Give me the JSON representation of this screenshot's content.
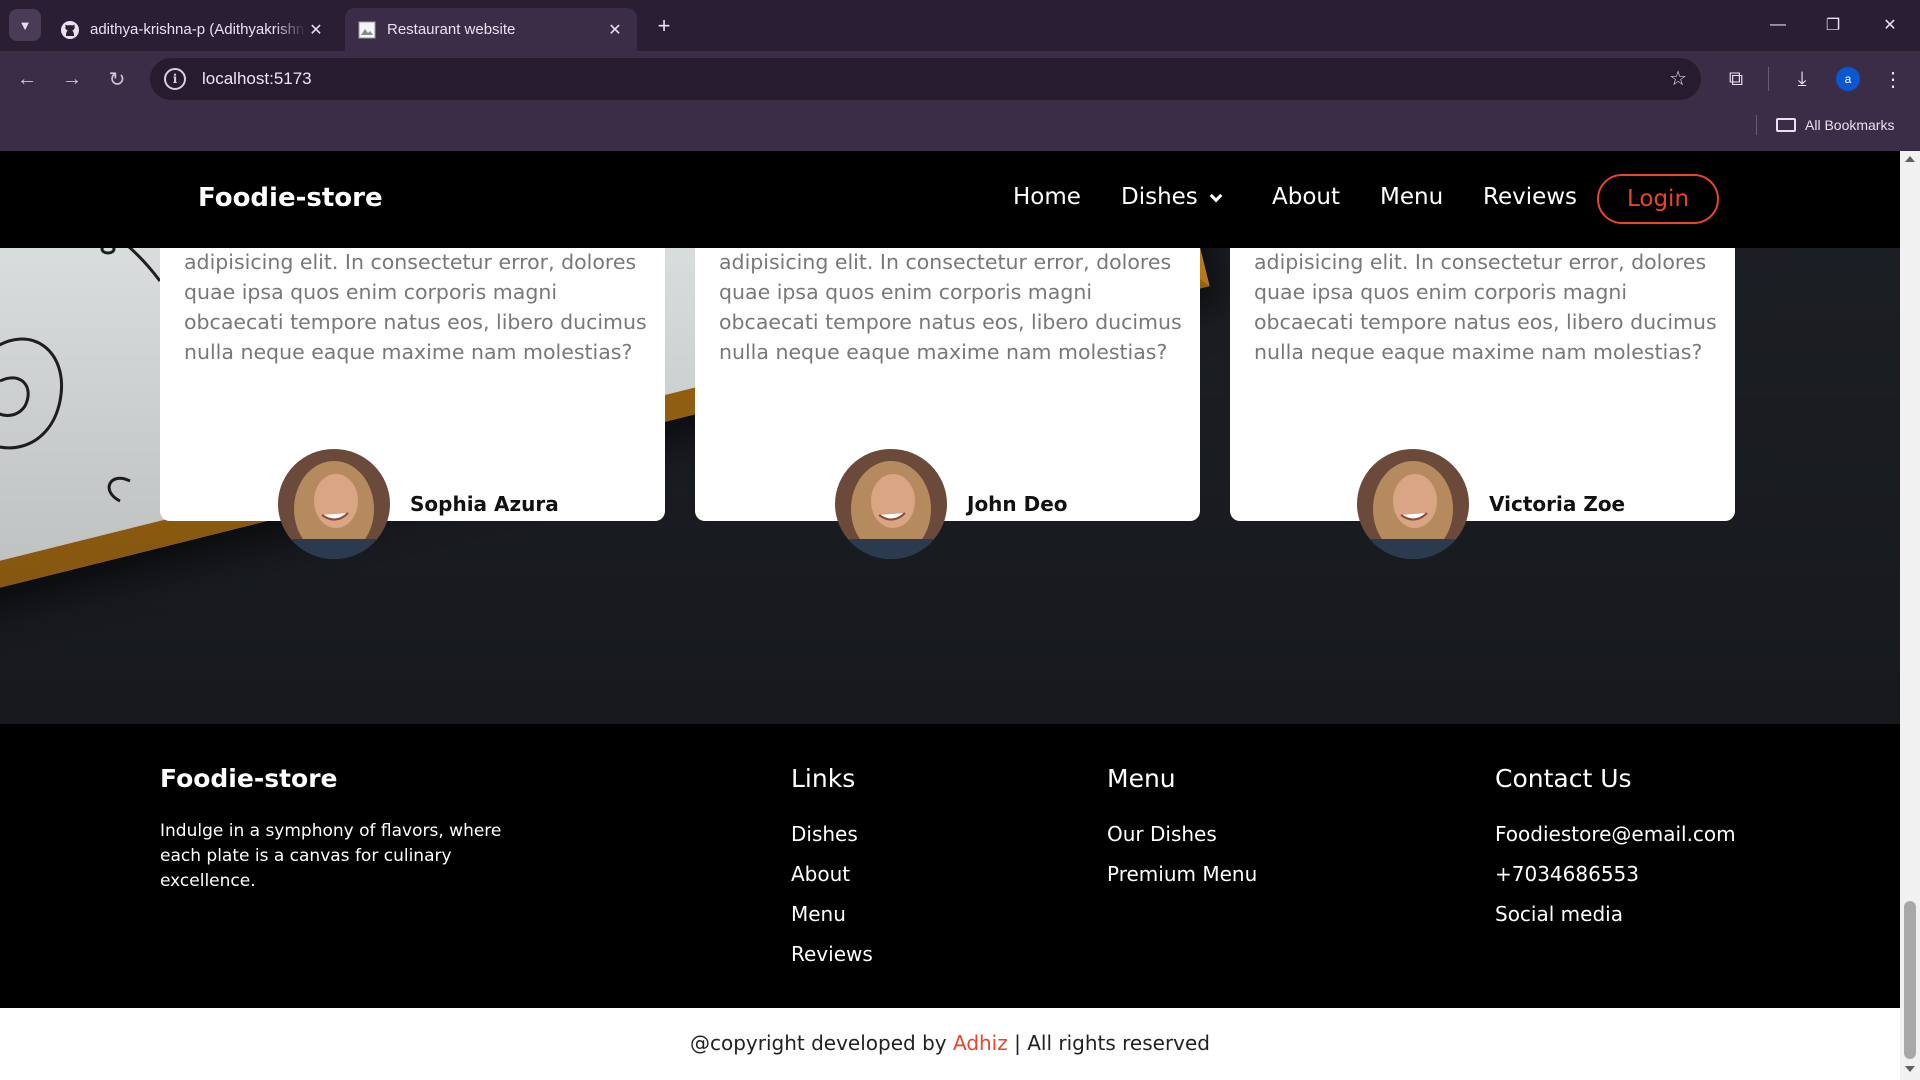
{
  "browser": {
    "tabs": [
      {
        "title": "adithya-krishna-p (Adithyakrishna",
        "active": false
      },
      {
        "title": "Restaurant website",
        "active": true
      }
    ],
    "url": "localhost:5173",
    "profile_initial": "a",
    "bookmarks_label": "All Bookmarks"
  },
  "navbar": {
    "brand": "Foodie-store",
    "links": [
      "Home",
      "Dishes",
      "About",
      "Menu",
      "Reviews"
    ],
    "login": "Login"
  },
  "reviews": [
    {
      "text": "adipisicing elit. In consectetur error, dolores quae ipsa quos enim corporis magni obcaecati tempore natus eos, libero ducimus nulla neque eaque maxime nam molestias?",
      "name": "Sophia Azura"
    },
    {
      "text": "adipisicing elit. In consectetur error, dolores quae ipsa quos enim corporis magni obcaecati tempore natus eos, libero ducimus nulla neque eaque maxime nam molestias?",
      "name": "John Deo"
    },
    {
      "text": "adipisicing elit. In consectetur error, dolores quae ipsa quos enim corporis magni obcaecati tempore natus eos, libero ducimus nulla neque eaque maxime nam molestias?",
      "name": "Victoria Zoe"
    }
  ],
  "footer": {
    "brand": "Foodie-store",
    "tagline": "Indulge in a symphony of flavors, where each plate is a canvas for culinary excellence.",
    "links": {
      "title": "Links",
      "items": [
        "Dishes",
        "About",
        "Menu",
        "Reviews"
      ]
    },
    "menu": {
      "title": "Menu",
      "items": [
        "Our Dishes",
        "Premium Menu"
      ]
    },
    "contact": {
      "title": "Contact Us",
      "items": [
        "Foodiestore@email.com",
        "+7034686553",
        "Social media"
      ]
    }
  },
  "copyright": {
    "prefix": "@copyright developed by ",
    "author": "Adhiz",
    "suffix": " | All rights reserved"
  },
  "colors": {
    "accent": "#e8452c",
    "navbar_bg": "#000000",
    "footer_bg": "#000000",
    "card_bg": "#ffffff"
  }
}
